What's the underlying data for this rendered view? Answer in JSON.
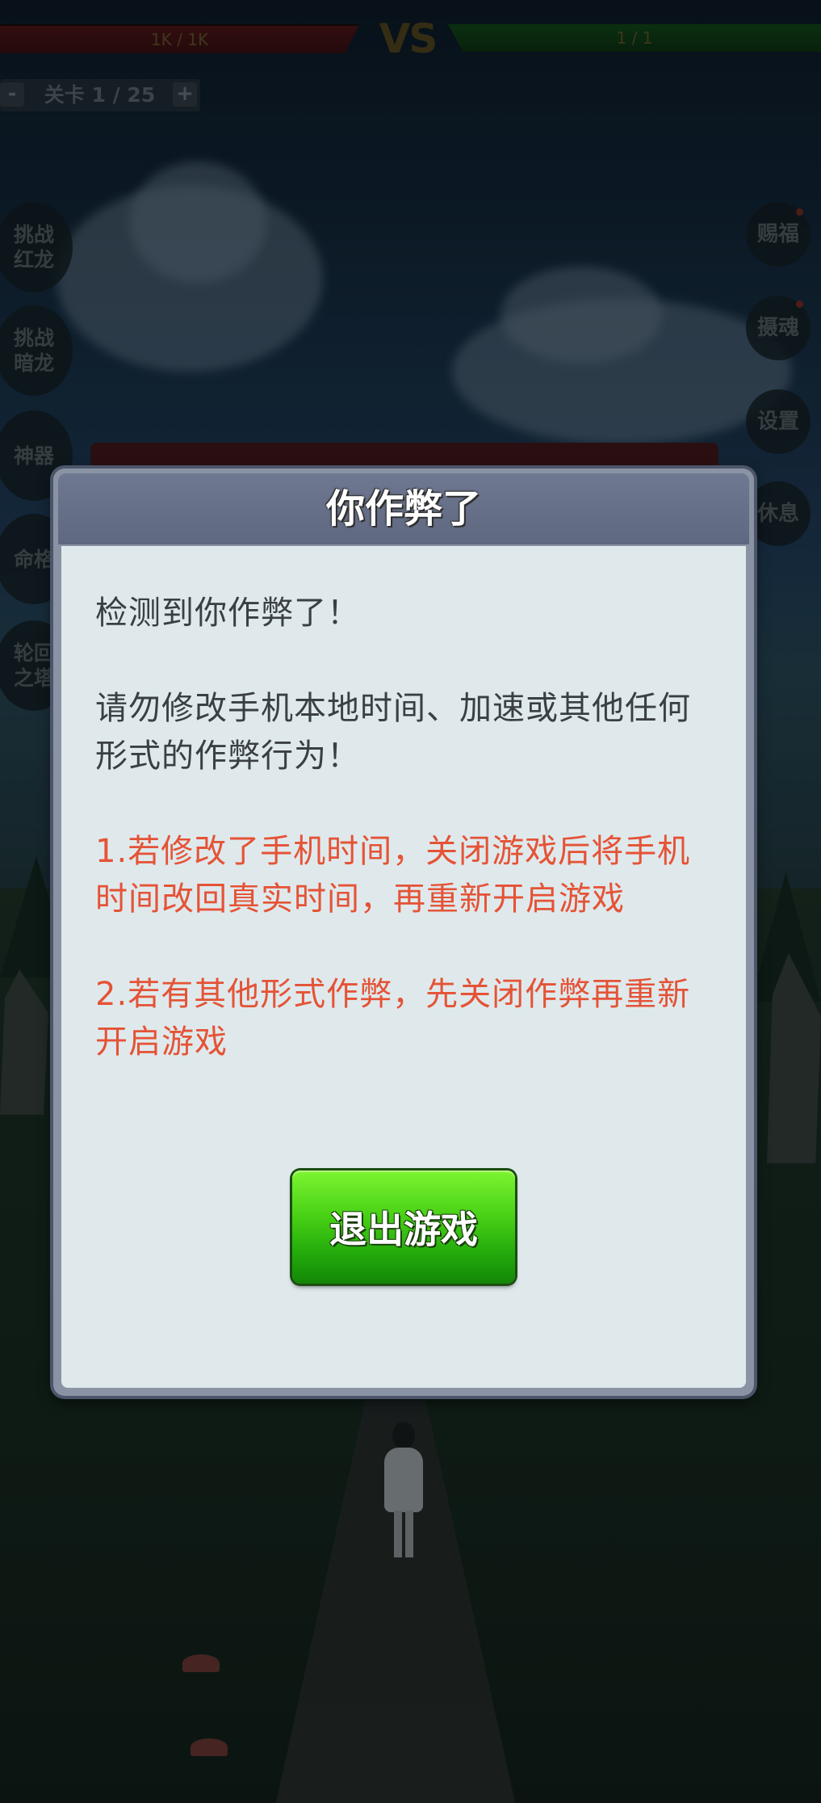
{
  "hud": {
    "player_hp": "1K / 1K",
    "vs": "VS",
    "enemy_hp": "1 / 1",
    "level_minus": "-",
    "level_text": "关卡 1 / 25",
    "level_plus": "+"
  },
  "left_buttons": [
    {
      "label": "挑战\n红龙"
    },
    {
      "label": "挑战\n暗龙"
    },
    {
      "label": "神器"
    },
    {
      "label": "命格"
    },
    {
      "label": "轮回\n之塔"
    }
  ],
  "right_buttons": [
    {
      "label": "赐福"
    },
    {
      "label": "摄魂"
    },
    {
      "label": "设置"
    },
    {
      "label": "休息"
    }
  ],
  "dialog": {
    "title": "你作弊了",
    "line1": "检测到你作弊了！",
    "line2": "请勿修改手机本地时间、加速或其他任何形式的作弊行为！",
    "line3": "1.若修改了手机时间，关闭游戏后将手机时间改回真实时间，再重新开启游戏",
    "line4": "2.若有其他形式作弊，先关闭作弊再重新开启游戏",
    "exit_button": "退出游戏"
  },
  "colors": {
    "warning_text": "#e55336",
    "body_text": "#3a3f44",
    "exit_button": "#3fcc12",
    "dialog_panel": "#dfe9ec"
  }
}
